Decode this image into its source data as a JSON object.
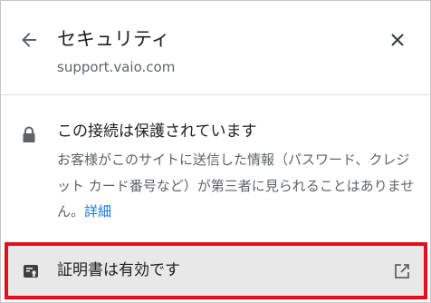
{
  "header": {
    "title": "セキュリティ",
    "site": "support.vaio.com"
  },
  "security": {
    "heading": "この接続は保護されています",
    "description_lines": [
      "お客様がこのサイトに送信した情報（パスワード、クレジ",
      "ット カード番号など）が第三者に見られることはありませ",
      "ん。"
    ],
    "details_link": "詳細"
  },
  "certificate": {
    "label": "証明書は有効です"
  },
  "icons": {
    "back": "arrow-back-icon",
    "close": "close-icon",
    "lock": "lock-icon",
    "certificate": "certificate-icon",
    "external": "open-external-icon"
  },
  "colors": {
    "link": "#1a73e8",
    "highlight_border": "#e0101e",
    "row_background": "#e8e8e8"
  }
}
